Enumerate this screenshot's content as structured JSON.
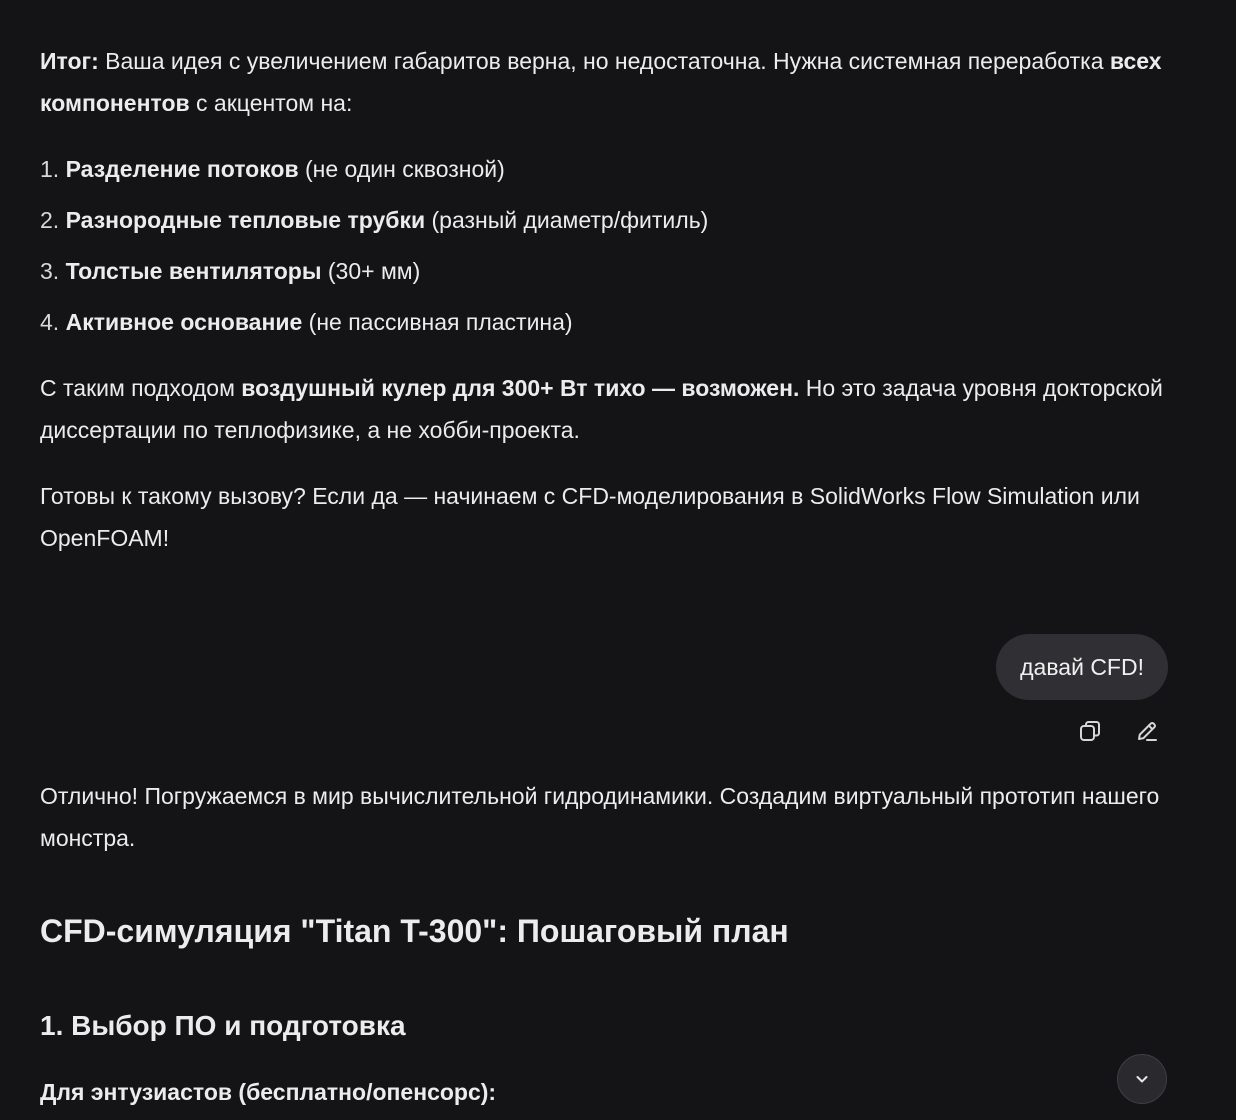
{
  "assistant_message_1": {
    "summary_label": "Итог:",
    "summary_text_1": " Ваша идея с увеличением габаритов верна, но недостаточна. Нужна системная переработка ",
    "summary_bold": "всех компонентов",
    "summary_text_2": " с акцентом на:",
    "list": [
      {
        "num": "1.",
        "bold": "Разделение потоков",
        "rest": " (не один сквозной)"
      },
      {
        "num": "2.",
        "bold": "Разнородные тепловые трубки",
        "rest": " (разный диаметр/фитиль)"
      },
      {
        "num": "3.",
        "bold": "Толстые вентиляторы",
        "rest": " (30+ мм)"
      },
      {
        "num": "4.",
        "bold": "Активное основание",
        "rest": " (не пассивная пластина)"
      }
    ],
    "approach_text_1": "С таким подходом ",
    "approach_bold": "воздушный кулер для 300+ Вт тихо — возможен.",
    "approach_text_2": " Но это задача уровня докторской диссертации по теплофизике, а не хобби-проекта.",
    "challenge_text": "Готовы к такому вызову? Если да — начинаем с CFD-моделирования в SolidWorks Flow Simulation или OpenFOAM!"
  },
  "user_message": {
    "text": "давай CFD!",
    "copy_icon": "copy-icon",
    "edit_icon": "pencil-icon"
  },
  "assistant_message_2": {
    "intro": "Отлично! Погружаемся в мир вычислительной гидродинамики. Создадим виртуальный прототип нашего монстра.",
    "heading": "CFD-симуляция \"Titan T-300\": Пошаговый план",
    "subheading": "1. Выбор ПО и подготовка",
    "subsection": "Для энтузиастов (бесплатно/опенсорс):"
  },
  "scroll_button": {
    "icon": "chevron-down-icon"
  }
}
